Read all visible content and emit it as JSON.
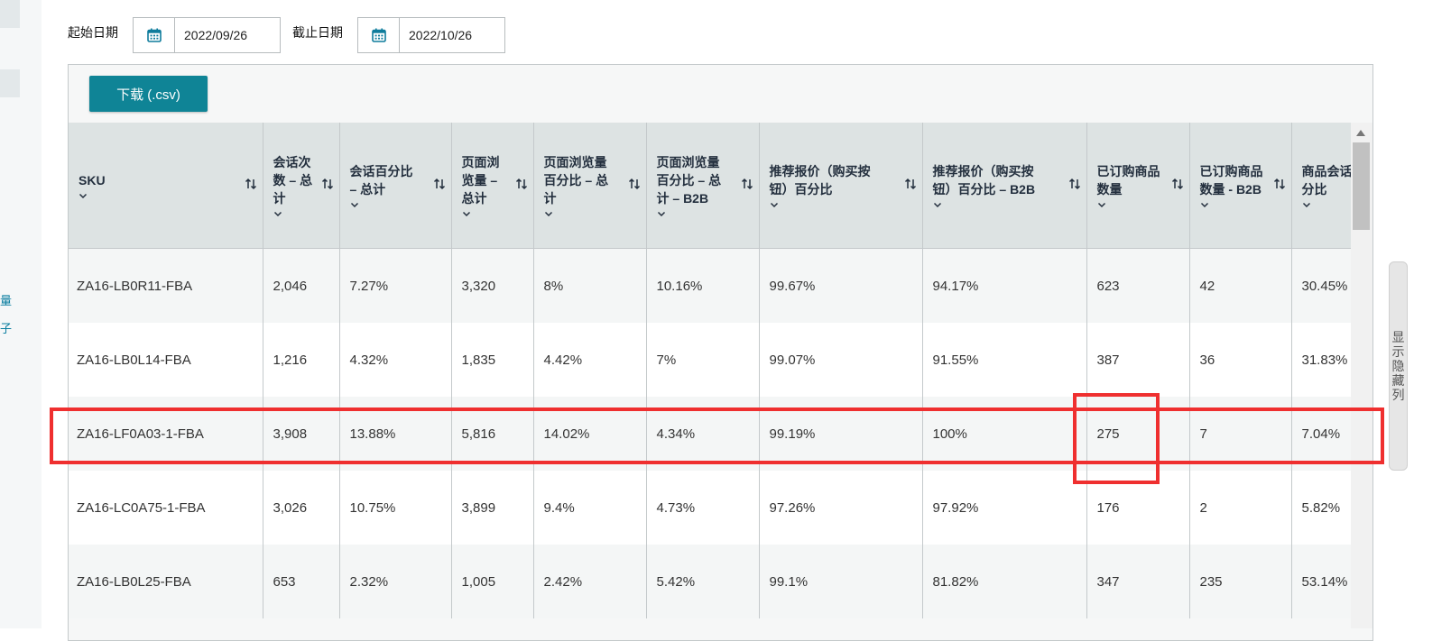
{
  "sidebar": {
    "text_1": "量",
    "text_2": "子"
  },
  "filters": {
    "start_label": "起始日期",
    "start_value": "2022/09/26",
    "end_label": "截止日期",
    "end_value": "2022/10/26"
  },
  "toolbar": {
    "download_label": "下载 (.csv)"
  },
  "table": {
    "columns": [
      {
        "lines": [
          "SKU"
        ]
      },
      {
        "lines": [
          "会话次",
          "数 – 总",
          "计"
        ]
      },
      {
        "lines": [
          "会话百分比",
          "– 总计"
        ]
      },
      {
        "lines": [
          "页面浏",
          "览量 –",
          "总计"
        ]
      },
      {
        "lines": [
          "页面浏览量",
          "百分比 – 总",
          "计"
        ]
      },
      {
        "lines": [
          "页面浏览量",
          "百分比 – 总",
          "计 – B2B"
        ]
      },
      {
        "lines": [
          "推荐报价（购买按",
          "钮）百分比"
        ]
      },
      {
        "lines": [
          "推荐报价（购买按",
          "钮）百分比 – B2B"
        ]
      },
      {
        "lines": [
          "已订购商品",
          "数量"
        ]
      },
      {
        "lines": [
          "已订购商品",
          "数量 - B2B"
        ]
      },
      {
        "lines": [
          "商品会话",
          "分比"
        ]
      }
    ],
    "rows": [
      [
        "ZA16-LB0R11-FBA",
        "2,046",
        "7.27%",
        "3,320",
        "8%",
        "10.16%",
        "99.67%",
        "94.17%",
        "623",
        "42",
        "30.45%"
      ],
      [
        "ZA16-LB0L14-FBA",
        "1,216",
        "4.32%",
        "1,835",
        "4.42%",
        "7%",
        "99.07%",
        "91.55%",
        "387",
        "36",
        "31.83%"
      ],
      [
        "ZA16-LF0A03-1-FBA",
        "3,908",
        "13.88%",
        "5,816",
        "14.02%",
        "4.34%",
        "99.19%",
        "100%",
        "275",
        "7",
        "7.04%"
      ],
      [
        "ZA16-LC0A75-1-FBA",
        "3,026",
        "10.75%",
        "3,899",
        "9.4%",
        "4.73%",
        "97.26%",
        "97.92%",
        "176",
        "2",
        "5.82%"
      ],
      [
        "ZA16-LB0L25-FBA",
        "653",
        "2.32%",
        "1,005",
        "2.42%",
        "5.42%",
        "99.1%",
        "81.82%",
        "347",
        "235",
        "53.14%"
      ]
    ]
  },
  "side_tab": {
    "label": "显示隐藏列"
  },
  "colors": {
    "accent": "#0f8496",
    "highlight": "#ef2f2f",
    "header_bg": "#dde3e3"
  }
}
